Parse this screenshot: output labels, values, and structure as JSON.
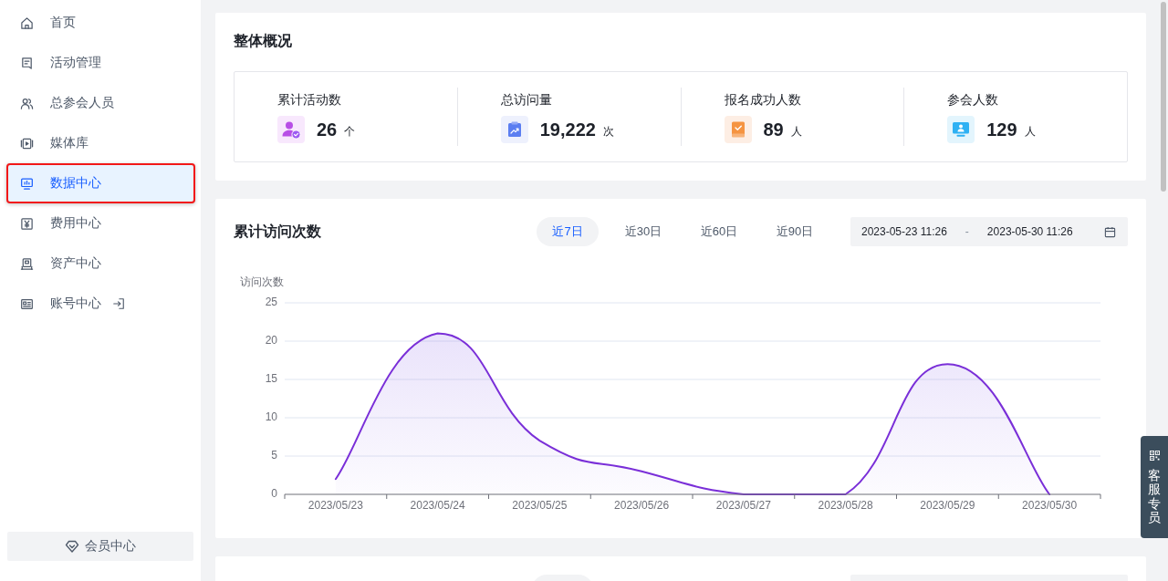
{
  "sidebar": {
    "items": [
      {
        "label": "首页",
        "selected": false,
        "highlighted": false
      },
      {
        "label": "活动管理",
        "selected": false,
        "highlighted": false
      },
      {
        "label": "总参会人员",
        "selected": false,
        "highlighted": false
      },
      {
        "label": "媒体库",
        "selected": false,
        "highlighted": false
      },
      {
        "label": "数据中心",
        "selected": true,
        "highlighted": true
      },
      {
        "label": "费用中心",
        "selected": false,
        "highlighted": false
      },
      {
        "label": "资产中心",
        "selected": false,
        "highlighted": false
      },
      {
        "label": "账号中心",
        "selected": false,
        "highlighted": false
      }
    ],
    "member_button": {
      "label": "会员中心"
    }
  },
  "overview": {
    "title": "整体概况",
    "stats": [
      {
        "label": "累计活动数",
        "value": "26",
        "unit": "个"
      },
      {
        "label": "总访问量",
        "value": "19,222",
        "unit": "次"
      },
      {
        "label": "报名成功人数",
        "value": "89",
        "unit": "人"
      },
      {
        "label": "参会人数",
        "value": "129",
        "unit": "人"
      }
    ]
  },
  "visits": {
    "title": "累计访问次数",
    "tabs": [
      {
        "label": "近7日",
        "selected": true
      },
      {
        "label": "近30日",
        "selected": false
      },
      {
        "label": "近60日",
        "selected": false
      },
      {
        "label": "近90日",
        "selected": false
      }
    ],
    "date_range": {
      "start": "2023-05-23 11:26",
      "separator": "-",
      "end": "2023-05-30 11:26"
    },
    "chart_data": {
      "type": "area",
      "ylabel": "访问次数",
      "categories": [
        "2023/05/23",
        "2023/05/24",
        "2023/05/25",
        "2023/05/26",
        "2023/05/27",
        "2023/05/28",
        "2023/05/29",
        "2023/05/30"
      ],
      "values": [
        2,
        21,
        7,
        3,
        0,
        0,
        17,
        0
      ],
      "ylim": [
        0,
        25
      ],
      "yticks": [
        0,
        5,
        10,
        15,
        20,
        25
      ],
      "grid": true
    }
  },
  "support_button": {
    "label": "客服专员"
  }
}
